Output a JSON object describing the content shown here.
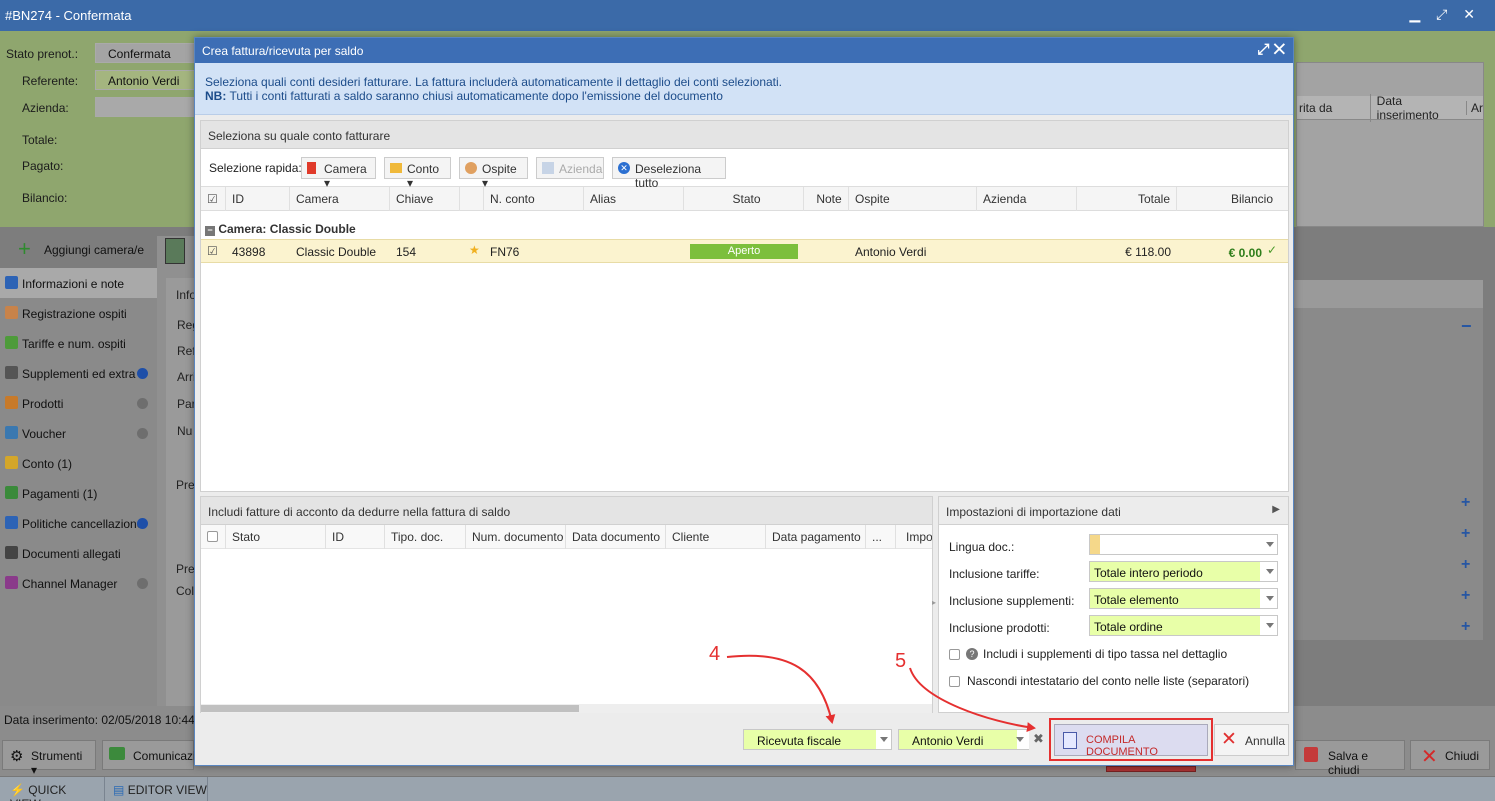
{
  "bg": {
    "title": "#BN274 - Confermata",
    "stato_label": "Stato prenot.:",
    "stato_value": "Confermata",
    "referente_label": "Referente:",
    "referente_value": "Antonio Verdi",
    "azienda_label": "Azienda:",
    "totale_label": "Totale:",
    "pagato_label": "Pagato:",
    "bilancio_label": "Bilancio:",
    "grid_cols": [
      "rita da",
      "Data inserimento",
      "Ar"
    ],
    "add_room": "Aggiungi camera/e",
    "sidebar": [
      {
        "label": "Informazioni e note",
        "color": "#2d63b5",
        "dot": ""
      },
      {
        "label": "Registrazione ospiti",
        "color": "#c8834a",
        "dot": ""
      },
      {
        "label": "Tariffe e num. ospiti",
        "color": "#4e9b3a",
        "dot": ""
      },
      {
        "label": "Supplementi ed extra",
        "color": "#555",
        "dot": "#1e4fa8"
      },
      {
        "label": "Prodotti",
        "color": "#c77a2a",
        "dot": "#6e6e6e"
      },
      {
        "label": "Voucher",
        "color": "#3a78b0",
        "dot": "#6e6e6e"
      },
      {
        "label": "Conto (1)",
        "color": "#d4a62a",
        "dot": ""
      },
      {
        "label": "Pagamenti (1)",
        "color": "#3a8a3a",
        "dot": ""
      },
      {
        "label": "Politiche cancellazione",
        "color": "#2d63b5",
        "dot": "#1e4fa8"
      },
      {
        "label": "Documenti allegati",
        "color": "#444",
        "dot": ""
      },
      {
        "label": "Channel Manager",
        "color": "#8a3a8a",
        "dot": "#6e6e6e"
      }
    ],
    "mid_fragments": [
      "Info",
      "Reg",
      "Refe",
      "Arri",
      "Par",
      "Nu",
      "Pre",
      "Pre",
      "Col"
    ],
    "data_inserimento": "Data inserimento:  02/05/2018 10:44",
    "strumenti": "Strumenti",
    "comunicazioni": "Comunicazio",
    "salva_chiudi": "Salva e chiudi",
    "chiudi": "Chiudi",
    "quick_view": "QUICK VIEW",
    "editor_view": "EDITOR VIEW"
  },
  "modal": {
    "title": "Crea fattura/ricevuta per saldo",
    "info_line1": "Seleziona quali conti desideri fatturare. La fattura includerà automaticamente il dettaglio dei conti selezionati.",
    "info_nb": "NB:",
    "info_line2": " Tutti i conti fatturati a saldo saranno chiusi automaticamente dopo l'emissione del documento",
    "section1_title": "Seleziona su quale conto fatturare",
    "quick_select": "Selezione rapida:",
    "btn_camera": "Camera",
    "btn_conto": "Conto",
    "btn_ospite": "Ospite",
    "btn_azienda": "Azienda",
    "btn_deselect": "Deseleziona tutto",
    "columns": [
      "ID",
      "Camera",
      "Chiave",
      "",
      "N. conto",
      "Alias",
      "Stato",
      "Note",
      "Ospite",
      "Azienda",
      "Totale",
      "Bilancio"
    ],
    "group_label": "Camera: Classic Double",
    "row": {
      "id": "43898",
      "camera": "Classic Double",
      "chiave": "154",
      "nconto": "FN76",
      "stato": "Aperto",
      "ospite": "Antonio Verdi",
      "totale": "€ 118.00",
      "bilancio": "€ 0.00"
    },
    "section2_title": "Includi fatture di acconto da dedurre nella fattura di saldo",
    "columns2": [
      "Stato",
      "ID",
      "Tipo. doc.",
      "Num. documento",
      "Data documento",
      "Cliente",
      "Data pagamento",
      "...",
      "Impor"
    ],
    "section3_title": "Impostazioni di importazione dati",
    "lingua_label": "Lingua doc.:",
    "lingua_value": "",
    "tariffe_label": "Inclusione tariffe:",
    "tariffe_value": "Totale intero periodo",
    "supplementi_label": "Inclusione supplementi:",
    "supplementi_value": "Totale elemento",
    "prodotti_label": "Inclusione prodotti:",
    "prodotti_value": "Totale ordine",
    "chk1": "Includi i supplementi di tipo tassa nel dettaglio",
    "chk2": "Nascondi intestatario del conto nelle liste (separatori)",
    "doc_type": "Ricevuta fiscale",
    "doc_client": "Antonio Verdi",
    "compila": "COMPILA DOCUMENTO",
    "annulla": "Annulla"
  },
  "annotations": {
    "n4": "4",
    "n5": "5",
    "color": "#e53030"
  }
}
